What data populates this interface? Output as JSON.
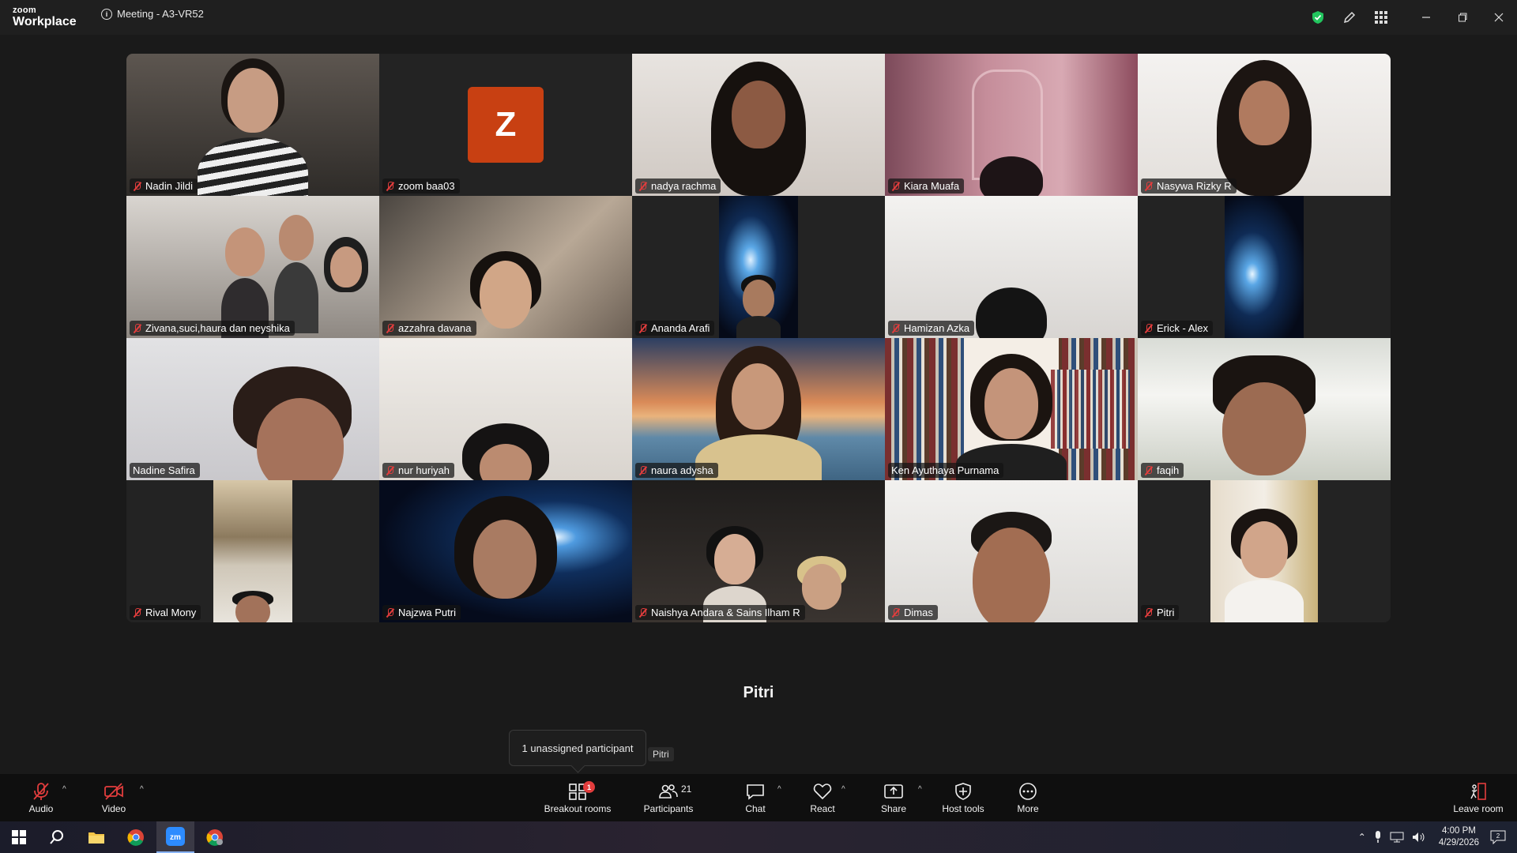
{
  "app": {
    "logo_line1": "zoom",
    "logo_line2": "Workplace",
    "meeting_title": "Meeting - A3-VR52"
  },
  "colors": {
    "accent_green": "#2dd882",
    "mute_red": "#e23d3d",
    "avatar_orange": "#c84012"
  },
  "participants": [
    {
      "name": "Nadin Jildi",
      "muted": true
    },
    {
      "name": "zoom baa03",
      "muted": true,
      "avatar_letter": "Z"
    },
    {
      "name": "nadya rachma",
      "muted": true
    },
    {
      "name": "Kiara Muafa",
      "muted": true
    },
    {
      "name": "Nasywa Rizky R",
      "muted": true
    },
    {
      "name": "Zivana,suci,haura dan neyshika",
      "muted": true
    },
    {
      "name": "azzahra davana",
      "muted": true
    },
    {
      "name": "Ananda Arafi",
      "muted": true
    },
    {
      "name": "Hamizan Azka",
      "muted": true
    },
    {
      "name": "Erick - Alex",
      "muted": true
    },
    {
      "name": "Nadine Safira",
      "muted": false
    },
    {
      "name": "nur huriyah",
      "muted": true
    },
    {
      "name": "naura adysha",
      "muted": true
    },
    {
      "name": "Ken Ayuthaya Purnama",
      "muted": false,
      "active_speaker": true
    },
    {
      "name": "faqih",
      "muted": true
    },
    {
      "name": "Rival Mony",
      "muted": true
    },
    {
      "name": "Najzwa Putri",
      "muted": true
    },
    {
      "name": "Naishya Andara & Sains Ilham R",
      "muted": true
    },
    {
      "name": "Dimas",
      "muted": true
    },
    {
      "name": "Pitri",
      "muted": true
    }
  ],
  "speaker_name": "Pitri",
  "tooltip": {
    "text": "1 unassigned participant",
    "hover_name": "Pitri"
  },
  "toolbar": {
    "audio": "Audio",
    "video": "Video",
    "breakout": "Breakout rooms",
    "breakout_badge": "1",
    "participants": "Participants",
    "participants_count": "21",
    "chat": "Chat",
    "react": "React",
    "share": "Share",
    "host_tools": "Host tools",
    "more": "More",
    "leave": "Leave room"
  },
  "taskbar": {
    "time": "4:00 PM",
    "date": "4/29/2026",
    "notifications": "2"
  }
}
